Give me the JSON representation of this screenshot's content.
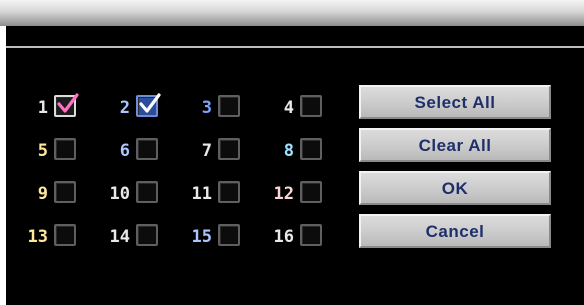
{
  "channels": [
    {
      "label": "1",
      "checked": true,
      "check_style": "a",
      "label_color": "#e9e9e9"
    },
    {
      "label": "2",
      "checked": true,
      "check_style": "b",
      "label_color": "#a9c6ff"
    },
    {
      "label": "3",
      "checked": false,
      "label_color": "#7aa6ff"
    },
    {
      "label": "4",
      "checked": false,
      "label_color": "#e9e9e9"
    },
    {
      "label": "5",
      "checked": false,
      "label_color": "#ffe79b"
    },
    {
      "label": "6",
      "checked": false,
      "label_color": "#a9c6ff"
    },
    {
      "label": "7",
      "checked": false,
      "label_color": "#e9e9e9"
    },
    {
      "label": "8",
      "checked": false,
      "label_color": "#9fe2ff"
    },
    {
      "label": "9",
      "checked": false,
      "label_color": "#ffe79b"
    },
    {
      "label": "10",
      "checked": false,
      "label_color": "#e9e9e9"
    },
    {
      "label": "11",
      "checked": false,
      "label_color": "#e9e9e9"
    },
    {
      "label": "12",
      "checked": false,
      "label_color": "#ffd6d6"
    },
    {
      "label": "13",
      "checked": false,
      "label_color": "#ffe79b"
    },
    {
      "label": "14",
      "checked": false,
      "label_color": "#e9e9e9"
    },
    {
      "label": "15",
      "checked": false,
      "label_color": "#a9c6ff"
    },
    {
      "label": "16",
      "checked": false,
      "label_color": "#e9e9e9"
    }
  ],
  "buttons": {
    "select_all": "Select All",
    "clear_all": "Clear All",
    "ok": "OK",
    "cancel": "Cancel"
  },
  "colors": {
    "dialog_background": "#000000",
    "button_text": "#1f2f6a",
    "check_mark_a": "#ff6fc2",
    "check_mark_b": "#ffffff"
  }
}
